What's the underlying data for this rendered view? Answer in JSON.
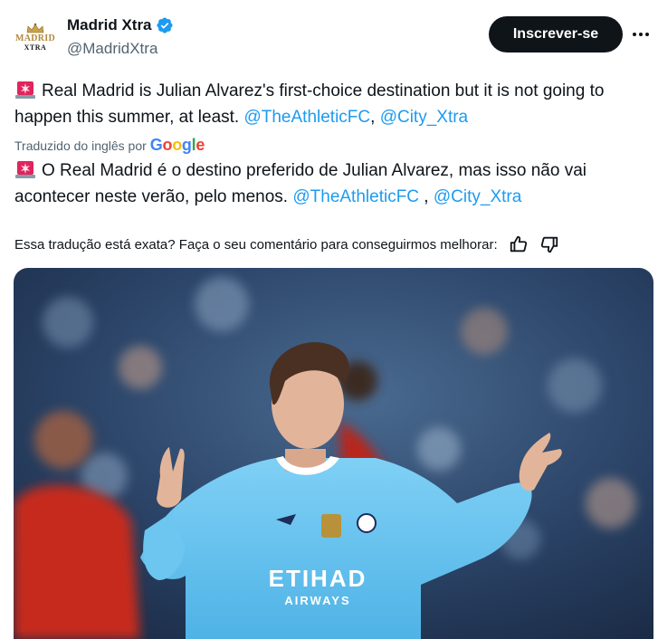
{
  "author": {
    "display_name": "Madrid Xtra",
    "handle": "@MadridXtra",
    "avatar_text_top": "MADRID",
    "avatar_text_bottom": "XTRA",
    "verified_color": "#1d9bf0"
  },
  "actions": {
    "subscribe_label": "Inscrever-se",
    "more_icon": "more-horizontal-icon"
  },
  "tweet": {
    "original_text": "Real Madrid is Julian Alvarez's first-choice destination but it is not going to happen this summer, at least.",
    "original_mentions": [
      "@TheAthleticFC",
      "@City_Xtra"
    ],
    "translated_by_label": "Traduzido do inglês por",
    "translator_brand": "Google",
    "translated_text": "O Real Madrid é o destino preferido de Julian Alvarez, mas isso não vai acontecer neste verão, pelo menos.",
    "translated_mentions": [
      "@TheAthleticFC",
      "@City_Xtra"
    ],
    "emoji_icon": "police-siren-icon",
    "mention_color": "#1d9bf0"
  },
  "feedback": {
    "question": "Essa tradução está exata? Faça o seu comentário para conseguirmos melhorar:",
    "thumbs_up_icon": "thumbs-up-icon",
    "thumbs_down_icon": "thumbs-down-icon"
  },
  "media": {
    "shirt_sponsor_line1": "ETIHAD",
    "shirt_sponsor_line2": "AIRWAYS",
    "shirt_color": "#6cc6f0"
  }
}
